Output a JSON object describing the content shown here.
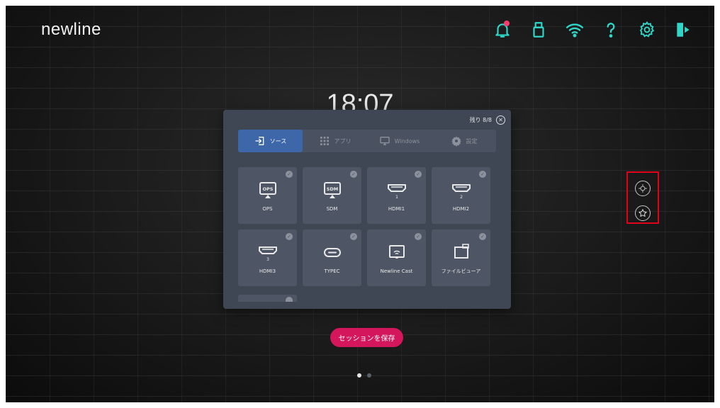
{
  "brand": {
    "logo": "newline"
  },
  "top_icons": [
    {
      "name": "notification-bell-icon",
      "color": "#30d6c8"
    },
    {
      "name": "usb-drive-icon",
      "color": "#30d6c8"
    },
    {
      "name": "wifi-icon",
      "color": "#30d6c8"
    },
    {
      "name": "help-icon",
      "color": "#30d6c8"
    },
    {
      "name": "settings-gear-icon",
      "color": "#30d6c8"
    },
    {
      "name": "exit-icon",
      "color": "#30d6c8"
    }
  ],
  "clock": {
    "time": "18:07"
  },
  "panel": {
    "remaining": "残り 8/8",
    "tabs": [
      {
        "label": "ソース",
        "icon": "source-input-icon",
        "active": true
      },
      {
        "label": "アプリ",
        "icon": "apps-grid-icon",
        "active": false
      },
      {
        "label": "Windows",
        "icon": "monitor-icon",
        "active": false
      },
      {
        "label": "設定",
        "icon": "settings-gear-icon",
        "active": false
      }
    ],
    "tiles": [
      {
        "label": "OPS",
        "icon": "ops-icon",
        "badge": "OPS"
      },
      {
        "label": "SDM",
        "icon": "sdm-icon",
        "badge": "SDM"
      },
      {
        "label": "HDMI1",
        "icon": "hdmi-icon",
        "badge": "1"
      },
      {
        "label": "HDMI2",
        "icon": "hdmi-icon",
        "badge": "2"
      },
      {
        "label": "HDMI3",
        "icon": "hdmi-icon",
        "badge": "3"
      },
      {
        "label": "TYPEC",
        "icon": "usb-c-icon",
        "badge": ""
      },
      {
        "label": "Newline Cast",
        "icon": "cast-icon",
        "badge": ""
      },
      {
        "label": "ファイルビューア",
        "icon": "file-viewer-icon",
        "badge": ""
      }
    ]
  },
  "side_tools": [
    {
      "name": "crosshair-target-icon"
    },
    {
      "name": "favorite-star-icon"
    }
  ],
  "save_button": {
    "label": "セッションを保存"
  },
  "pagination": {
    "pages": 2,
    "current": 1
  },
  "colors": {
    "accent": "#30d6c8",
    "primary": "#d4165d",
    "tab_active": "#3d67a8",
    "highlight": "#e3001b"
  }
}
